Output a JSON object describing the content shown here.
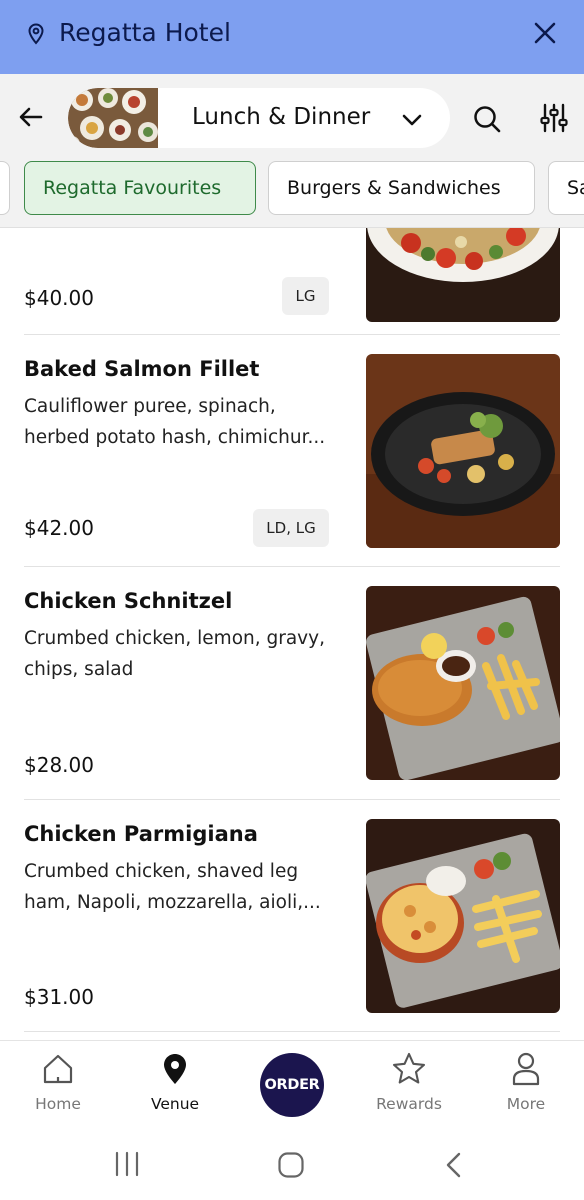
{
  "venue": {
    "name": "Regatta Hotel"
  },
  "menu": {
    "name": "Lunch & Dinner"
  },
  "categories": [
    "Regatta Favourites",
    "Burgers & Sandwiches",
    "Sa"
  ],
  "items": [
    {
      "title": "",
      "desc": [],
      "price": "$40.00",
      "tag": "LG"
    },
    {
      "title": "Baked Salmon Fillet",
      "desc": [
        "Cauliflower puree, spinach,",
        "herbed potato hash, chimichur..."
      ],
      "price": "$42.00",
      "tag": "LD, LG"
    },
    {
      "title": "Chicken Schnitzel",
      "desc": [
        "Crumbed chicken, lemon, gravy,",
        "chips, salad"
      ],
      "price": "$28.00",
      "tag": ""
    },
    {
      "title": "Chicken Parmigiana",
      "desc": [
        "Crumbed chicken, shaved leg",
        "ham, Napoli, mozzarella, aioli,..."
      ],
      "price": "$31.00",
      "tag": ""
    }
  ],
  "nav": {
    "home": "Home",
    "venue": "Venue",
    "order": "ORDER",
    "rewards": "Rewards",
    "more": "More"
  },
  "colors": {
    "banner": "#7e9ff0",
    "active_chip_bg": "#e3f3e4",
    "active_chip_text": "#1e6a2d",
    "order_button": "#1b154e"
  },
  "icons": [
    "location-pin-icon",
    "close-icon",
    "back-arrow-icon",
    "chevron-down-icon",
    "search-icon",
    "filter-sliders-icon",
    "home-icon",
    "venue-pin-icon",
    "star-icon",
    "person-icon",
    "recents-icon",
    "home-circle-icon",
    "system-back-icon"
  ]
}
